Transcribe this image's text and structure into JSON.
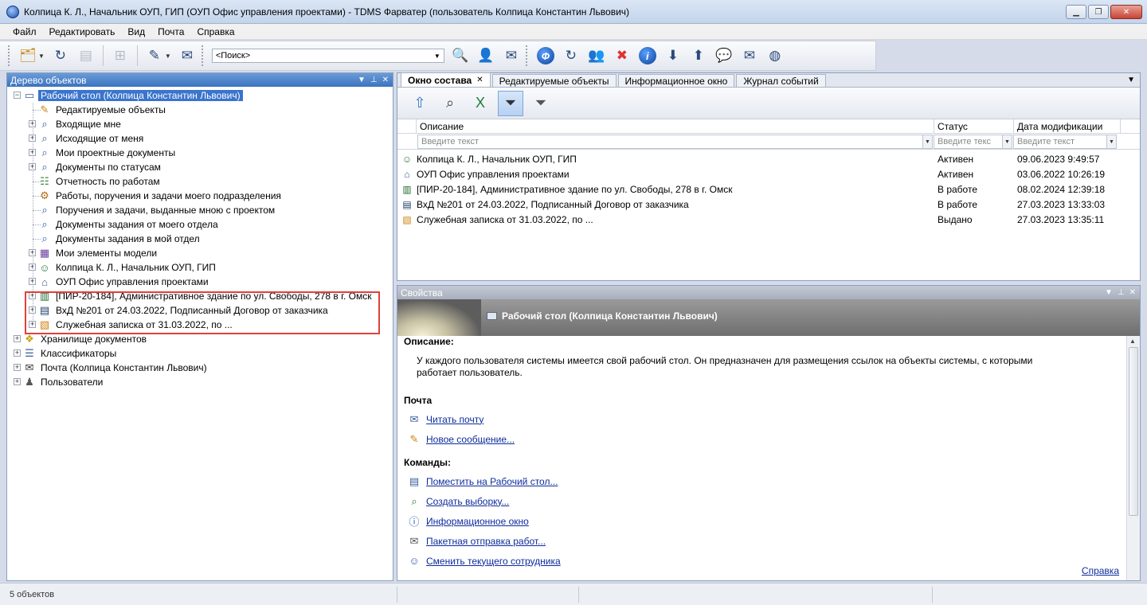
{
  "window": {
    "title": "Колпица К. Л., Начальник ОУП, ГИП (ОУП Офис управления проектами) - TDMS Фарватер (пользователь Колпица Константин Львович)"
  },
  "menu": [
    "Файл",
    "Редактировать",
    "Вид",
    "Почта",
    "Справка"
  ],
  "toolbar": {
    "search_value": "<Поиск>"
  },
  "left_panel": {
    "title": "Дерево объектов",
    "tree": [
      {
        "label": "Рабочий стол (Колпица Константин Львович)",
        "level": 0,
        "icon": "desktop-icon",
        "expander": "−",
        "selected": true
      },
      {
        "label": "Редактируемые объекты",
        "level": 1,
        "icon": "edit-doc-icon",
        "expander": ""
      },
      {
        "label": "Входящие мне",
        "level": 1,
        "icon": "query-icon",
        "expander": "+"
      },
      {
        "label": "Исходящие от меня",
        "level": 1,
        "icon": "query-icon",
        "expander": "+"
      },
      {
        "label": "Мои проектные документы",
        "level": 1,
        "icon": "query-icon",
        "expander": "+"
      },
      {
        "label": "Документы по статусам",
        "level": 1,
        "icon": "query-icon",
        "expander": "+"
      },
      {
        "label": "Отчетность по работам",
        "level": 1,
        "icon": "report-icon",
        "expander": ""
      },
      {
        "label": "Работы, поручения и задачи моего подразделения",
        "level": 1,
        "icon": "tasks-icon",
        "expander": ""
      },
      {
        "label": "Поручения и задачи, выданные мною с проектом",
        "level": 1,
        "icon": "query-icon",
        "expander": ""
      },
      {
        "label": "Документы задания от моего отдела",
        "level": 1,
        "icon": "query-icon",
        "expander": ""
      },
      {
        "label": "Документы задания в мой отдел",
        "level": 1,
        "icon": "query-icon",
        "expander": ""
      },
      {
        "label": "Мои элементы модели",
        "level": 1,
        "icon": "model-icon",
        "expander": "+"
      },
      {
        "label": "Колпица К. Л., Начальник ОУП, ГИП",
        "level": 1,
        "icon": "user-icon",
        "expander": "+"
      },
      {
        "label": "ОУП Офис управления проектами",
        "level": 1,
        "icon": "department-icon",
        "expander": "+"
      },
      {
        "label": "[ПИР-20-184], Административное здание по ул. Свободы, 278 в г. Омск",
        "level": 1,
        "icon": "project-icon",
        "expander": "+"
      },
      {
        "label": "ВхД №201 от 24.03.2022, Подписанный Договор от заказчика",
        "level": 1,
        "icon": "contract-icon",
        "expander": "+"
      },
      {
        "label": "Служебная записка от 31.03.2022, по ...",
        "level": 1,
        "icon": "memo-icon",
        "expander": "+"
      },
      {
        "label": "Хранилище документов",
        "level": 0,
        "icon": "storage-icon",
        "expander": "+"
      },
      {
        "label": "Классификаторы",
        "level": 0,
        "icon": "classifier-icon",
        "expander": "+"
      },
      {
        "label": "Почта (Колпица Константин Львович)",
        "level": 0,
        "icon": "mail-icon",
        "expander": "+"
      },
      {
        "label": "Пользователи",
        "level": 0,
        "icon": "users-icon",
        "expander": "+"
      }
    ]
  },
  "tabs": [
    {
      "label": "Окно состава",
      "active": true
    },
    {
      "label": "Редактируемые объекты",
      "active": false
    },
    {
      "label": "Информационное окно",
      "active": false
    },
    {
      "label": "Журнал событий",
      "active": false
    }
  ],
  "grid": {
    "columns": [
      "Описание",
      "Статус",
      "Дата модификации"
    ],
    "filters": [
      "Введите текст",
      "Введите текс",
      "Введите текст"
    ],
    "rows": [
      {
        "icon": "user-icon",
        "desc": "Колпица К. Л., Начальник ОУП, ГИП",
        "status": "Активен",
        "date": "09.06.2023 9:49:57"
      },
      {
        "icon": "department-icon",
        "desc": "ОУП Офис управления проектами",
        "status": "Активен",
        "date": "03.06.2022 10:26:19"
      },
      {
        "icon": "project-icon",
        "desc": "[ПИР-20-184], Административное здание по ул. Свободы, 278 в г. Омск",
        "status": "В работе",
        "date": "08.02.2024 12:39:18"
      },
      {
        "icon": "contract-icon",
        "desc": "ВхД №201 от 24.03.2022, Подписанный Договор от заказчика",
        "status": "В работе",
        "date": "27.03.2023 13:33:03"
      },
      {
        "icon": "memo-icon",
        "desc": "Служебная записка от 31.03.2022, по ...",
        "status": "Выдано",
        "date": "27.03.2023 13:35:11"
      }
    ]
  },
  "properties": {
    "panel_title": "Свойства",
    "banner_title": "Рабочий стол (Колпица Константин Львович)",
    "desc_heading": "Описание:",
    "desc_text": "У каждого пользователя системы имеется свой рабочий стол. Он предназначен для размещения ссылок на объекты системы, с которыми работает пользователь.",
    "mail_heading": "Почта",
    "mail_links": [
      {
        "label": "Читать почту",
        "icon": "envelope-icon"
      },
      {
        "label": "Новое сообщение...",
        "icon": "compose-icon"
      }
    ],
    "commands_heading": "Команды:",
    "command_links": [
      {
        "label": "Поместить на Рабочий стол...",
        "icon": "pin-icon"
      },
      {
        "label": "Создать выборку...",
        "icon": "search-people-icon"
      },
      {
        "label": "Информационное окно",
        "icon": "info-icon"
      },
      {
        "label": "Пакетная отправка работ...",
        "icon": "send-icon"
      },
      {
        "label": "Сменить текущего сотрудника",
        "icon": "switch-user-icon"
      }
    ],
    "help_link": "Справка"
  },
  "status_bar": {
    "text": "5 объектов"
  },
  "colors": {
    "accent": "#3a74cc",
    "highlight_frame": "#e0413a"
  }
}
